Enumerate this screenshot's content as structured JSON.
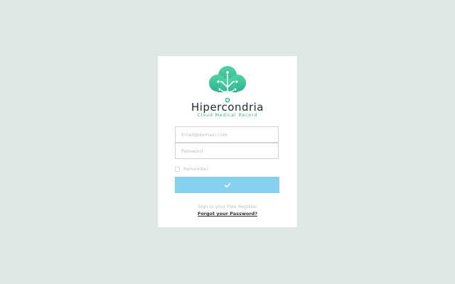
{
  "brand": {
    "name": "Hipercondria",
    "tagline": "Cloud Medical Record"
  },
  "form": {
    "email_placeholder": "Email@domain.com",
    "password_placeholder": "Password",
    "remember_label": "Remember",
    "submit_icon": "check-icon"
  },
  "links": {
    "register": "Sign in your Free Register",
    "forgot": "Forgot your Password?"
  },
  "colors": {
    "background": "#dfe8e4",
    "card": "#ffffff",
    "logo_green": "#3cc79a",
    "button": "#86d2ee",
    "tagline": "#39a98b"
  }
}
